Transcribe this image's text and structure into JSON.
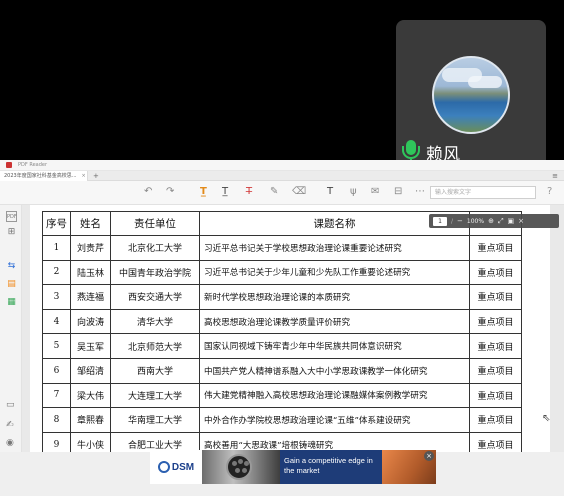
{
  "call": {
    "participant_name": "赖风"
  },
  "window": {
    "app_name": "PDF Reader",
    "tab_title": "2023年度国家社科基金高校思...",
    "tab_close": "×",
    "tab_add": "+",
    "menu": "≡"
  },
  "toolbar": {
    "search_placeholder": "输入搜索文字",
    "help": "?"
  },
  "table": {
    "headers": [
      "序号",
      "姓名",
      "责任单位",
      "课题名称",
      ""
    ],
    "rows": [
      {
        "no": "1",
        "name": "刘贵芹",
        "unit": "北京化工大学",
        "topic": "习近平总书记关于学校思想政治理论课重要论述研究",
        "type": "重点项目"
      },
      {
        "no": "2",
        "name": "陆玉林",
        "unit": "中国青年政治学院",
        "topic": "习近平总书记关于少年儿童和少先队工作重要论述研究",
        "type": "重点项目"
      },
      {
        "no": "3",
        "name": "燕连福",
        "unit": "西安交通大学",
        "topic": "新时代学校思想政治理论课的本质研究",
        "type": "重点项目"
      },
      {
        "no": "4",
        "name": "向波涛",
        "unit": "清华大学",
        "topic": "高校思想政治理论课教学质量评价研究",
        "type": "重点项目"
      },
      {
        "no": "5",
        "name": "吴玉军",
        "unit": "北京师范大学",
        "topic": "国家认同视域下铸牢青少年中华民族共同体意识研究",
        "type": "重点项目"
      },
      {
        "no": "6",
        "name": "邹绍清",
        "unit": "西南大学",
        "topic": "中国共产党人精神谱系融入大中小学思政课教学一体化研究",
        "type": "重点项目"
      },
      {
        "no": "7",
        "name": "梁大伟",
        "unit": "大连理工大学",
        "topic": "伟大建党精神融入高校思想政治理论课融媒体案例教学研究",
        "type": "重点项目"
      },
      {
        "no": "8",
        "name": "章熙春",
        "unit": "华南理工大学",
        "topic": "中外合作办学院校思想政治理论课“五维”体系建设研究",
        "type": "重点项目"
      },
      {
        "no": "9",
        "name": "牛小侠",
        "unit": "合肥工业大学",
        "topic": "高校善用“大思政课”培根铸魂研究",
        "type": "重点项目"
      }
    ]
  },
  "floatbar": {
    "page_value": "1",
    "page_sep": "/",
    "zoom": "100%"
  },
  "ad": {
    "brand": "DSM",
    "tagline": "Gain a competitive edge in the market",
    "close": "×"
  }
}
